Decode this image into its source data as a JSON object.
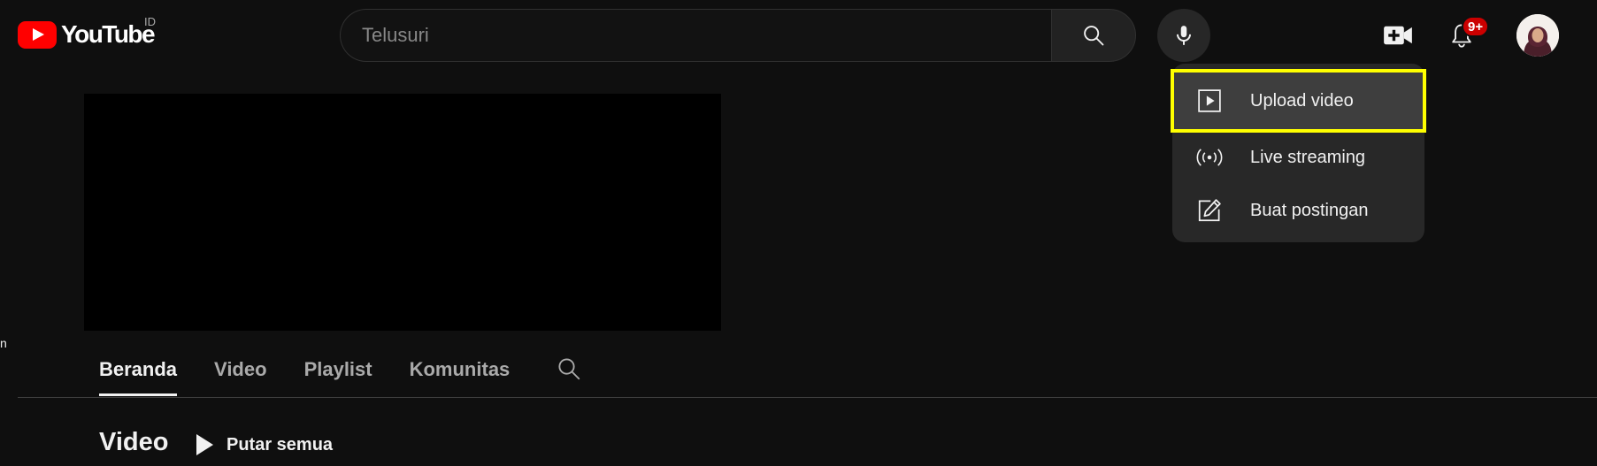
{
  "masthead": {
    "logo_text": "YouTube",
    "country_code": "ID",
    "search_placeholder": "Telusuri",
    "search_value": "",
    "notification_badge": "9+",
    "icons": {
      "search": "search-icon",
      "voice": "microphone-icon",
      "create": "video-camera-plus-icon",
      "notifications": "bell-icon",
      "avatar": "user-avatar"
    }
  },
  "create_menu": {
    "items": [
      {
        "label": "Upload video",
        "icon": "play-square-icon",
        "highlighted": true
      },
      {
        "label": "Live streaming",
        "icon": "broadcast-icon",
        "highlighted": false
      },
      {
        "label": "Buat postingan",
        "icon": "edit-post-icon",
        "highlighted": false
      }
    ],
    "highlight_color": "#ffff00"
  },
  "side_fragment": "n",
  "channel_tabs": {
    "items": [
      {
        "label": "Beranda",
        "active": true
      },
      {
        "label": "Video",
        "active": false
      },
      {
        "label": "Playlist",
        "active": false
      },
      {
        "label": "Komunitas",
        "active": false
      }
    ]
  },
  "section": {
    "title": "Video",
    "play_all_label": "Putar semua"
  },
  "colors": {
    "background": "#0f0f0f",
    "brand_red": "#ff0000",
    "badge_red": "#cc0000",
    "menu_background": "#282828"
  }
}
